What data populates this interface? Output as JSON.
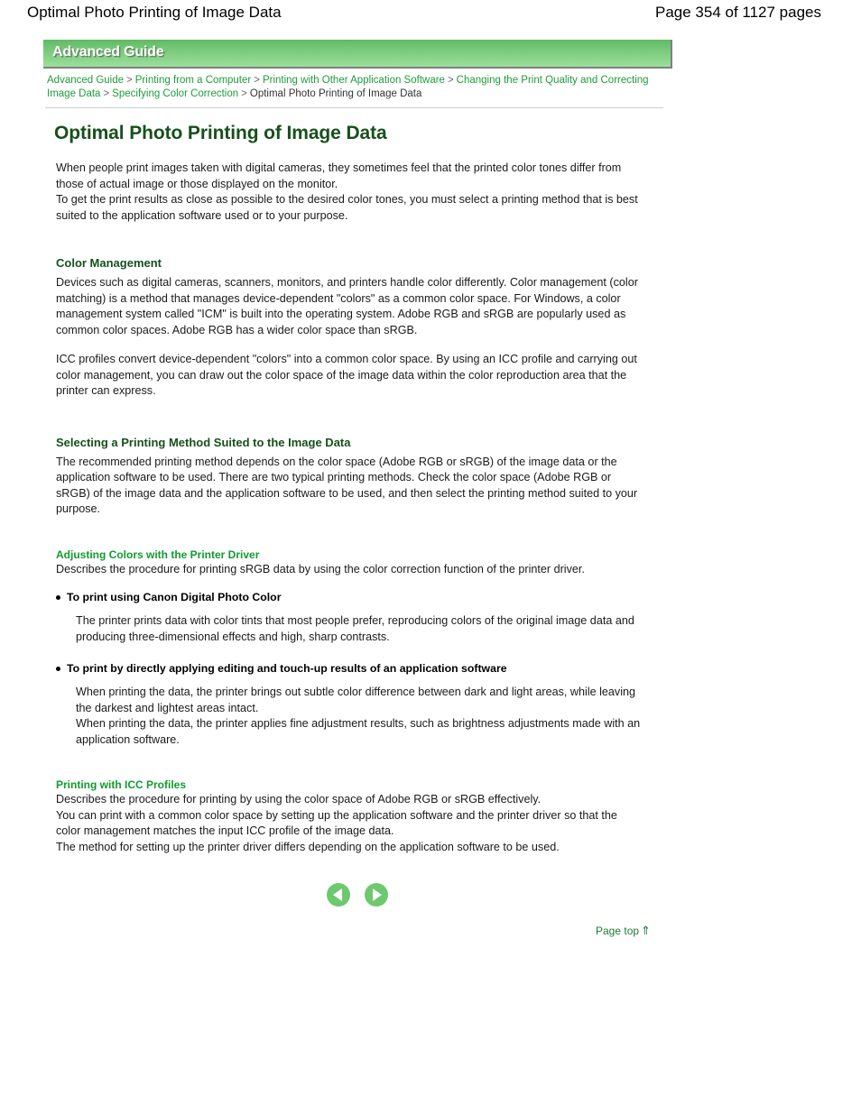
{
  "header": {
    "doc_title": "Optimal Photo Printing of Image Data",
    "page_count": "Page 354 of 1127 pages"
  },
  "banner": {
    "label": "Advanced Guide",
    "gradient_top": "#5fbb63",
    "gradient_bottom": "#9cdf9c"
  },
  "breadcrumb": {
    "separator": ">",
    "items": [
      {
        "label": "Advanced Guide",
        "current": false
      },
      {
        "label": "Printing from a Computer",
        "current": false
      },
      {
        "label": "Printing with Other Application Software",
        "current": false
      },
      {
        "label": "Changing the Print Quality and Correcting Image Data",
        "current": false
      },
      {
        "label": "Specifying Color Correction",
        "current": false
      },
      {
        "label": "Optimal Photo Printing of Image Data",
        "current": true
      }
    ]
  },
  "article": {
    "title": "Optimal Photo Printing of Image Data",
    "intro_p1": "When people print images taken with digital cameras, they sometimes feel that the printed color tones differ from those of actual image or those displayed on the monitor.",
    "intro_p2": "To get the print results as close as possible to the desired color tones, you must select a printing method that is best suited to the application software used or to your purpose.",
    "color_management": {
      "heading": "Color Management",
      "p1": "Devices such as digital cameras, scanners, monitors, and printers handle color differently. Color management (color matching) is a method that manages device-dependent \"colors\" as a common color space. For Windows, a color management system called \"ICM\" is built into the operating system. Adobe RGB and sRGB are popularly used as common color spaces. Adobe RGB has a wider color space than sRGB.",
      "p2": "ICC profiles convert device-dependent \"colors\" into a common color space. By using an ICC profile and carrying out color management, you can draw out the color space of the image data within the color reproduction area that the printer can express."
    },
    "selecting_method": {
      "heading": "Selecting a Printing Method Suited to the Image Data",
      "p1": "The recommended printing method depends on the color space (Adobe RGB or sRGB) of the image data or the application software to be used. There are two typical printing methods. Check the color space (Adobe RGB or sRGB) of the image data and the application software to be used, and then select the printing method suited to your purpose."
    },
    "adjusting_colors": {
      "heading": "Adjusting Colors with the Printer Driver",
      "description": "Describes the procedure for printing sRGB data by using the color correction function of the printer driver.",
      "bullets": [
        {
          "title": "To print using Canon Digital Photo Color",
          "body": "The printer prints data with color tints that most people prefer, reproducing colors of the original image data and producing three-dimensional effects and high, sharp contrasts."
        },
        {
          "title": "To print by directly applying editing and touch-up results of an application software",
          "body": "When printing the data, the printer brings out subtle color difference between dark and light areas, while leaving the darkest and lightest areas intact.\nWhen printing the data, the printer applies fine adjustment results, such as brightness adjustments made with an application software."
        }
      ]
    },
    "icc_profiles": {
      "heading": "Printing with ICC Profiles",
      "p1": "Describes the procedure for printing by using the color space of Adobe RGB or sRGB effectively.",
      "p2": "You can print with a common color space by setting up the application software and the printer driver so that the color management matches the input ICC profile of the image data.",
      "p3": "The method for setting up the printer driver differs depending on the application software to be used."
    }
  },
  "footer": {
    "prev_icon": "arrow-left-circle-icon",
    "next_icon": "arrow-right-circle-icon",
    "page_top_label": "Page top",
    "page_top_arrow": "⇑",
    "link_color": "#1f7a32"
  }
}
